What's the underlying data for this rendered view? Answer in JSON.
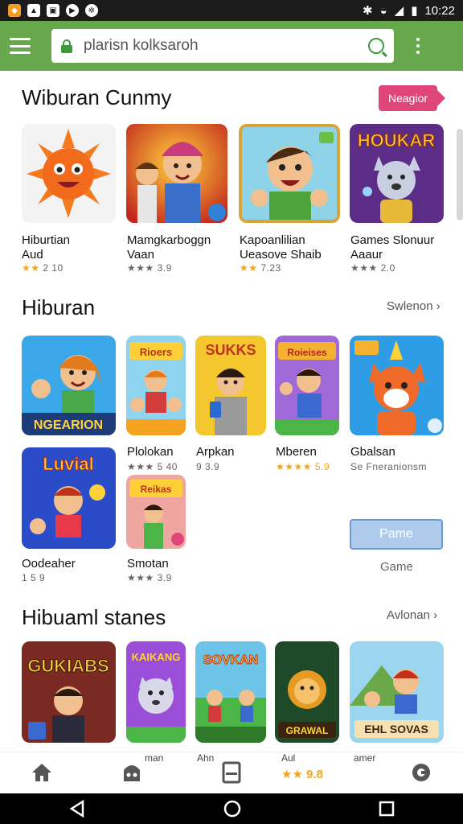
{
  "status_bar": {
    "time": "10:22",
    "left_icons": [
      "flame-app-icon",
      "image-icon",
      "gallery-icon",
      "play-icon",
      "settings-icon"
    ],
    "right_icons": [
      "bluetooth-icon",
      "wifi-icon",
      "signal-icon",
      "battery-icon"
    ]
  },
  "app_bar": {
    "search_placeholder": "plarisn kolksaroh",
    "color": "#66a84b"
  },
  "section1": {
    "title": "Wiburan Cunmy",
    "chip_label": "Neagior",
    "apps": [
      {
        "line1": "Hiburtian",
        "line2": "Aud",
        "stars": "★★",
        "rating": "2 10"
      },
      {
        "line1": "Mamgkarboggn",
        "line2": "Vaan",
        "stars": "★★★",
        "rating": "3.9"
      },
      {
        "line1": "Kapoanlilian",
        "line2": "Ueasove Shaib",
        "stars": "★★",
        "rating": "7.23"
      },
      {
        "line1": "Games Slonuur",
        "line2": "Aaaur",
        "stars": "★★★",
        "rating": "2.0"
      }
    ]
  },
  "section2": {
    "title": "Hiburan",
    "link": "Swlenon",
    "tile_titles": [
      "NGEARION",
      "Rioers",
      "SUKKS",
      "Roieises"
    ],
    "apps": [
      {
        "line1": "Plolokan",
        "line2": "★★★ 5 40"
      },
      {
        "line1": "Arpkan",
        "line2": "9 3.9"
      },
      {
        "line1": "Mberen",
        "line2": "★★★★ 5.9"
      },
      {
        "line1": "Gbalsan",
        "line2": "Se Fneranionsm"
      },
      {
        "line1": "Oodeaher",
        "line2": "1 5 9"
      },
      {
        "line1": "Smotan",
        "line2": "★★★ 3.9"
      }
    ],
    "tile_titles_2": [
      "Luvial",
      "Reikas"
    ],
    "button_label": "Pame",
    "button_caption": "Game"
  },
  "section3": {
    "title": "Hibuaml stanes",
    "link": "Avlonan",
    "tile_titles": [
      "GUKIABS",
      "KAIKANG",
      "SOVKAN",
      "GRAWAL",
      "EHL SOVAS"
    ],
    "partial_labels": [
      "man",
      "Ahn",
      "Aul",
      "amer"
    ]
  },
  "bottom_nav": {
    "items": [
      "home-icon",
      "game-icon",
      "apps-icon",
      "rating-icon",
      "profile-icon"
    ],
    "rating_text": "★★ 9.8"
  },
  "android_nav": [
    "back-icon",
    "home-circle-icon",
    "recents-icon"
  ]
}
